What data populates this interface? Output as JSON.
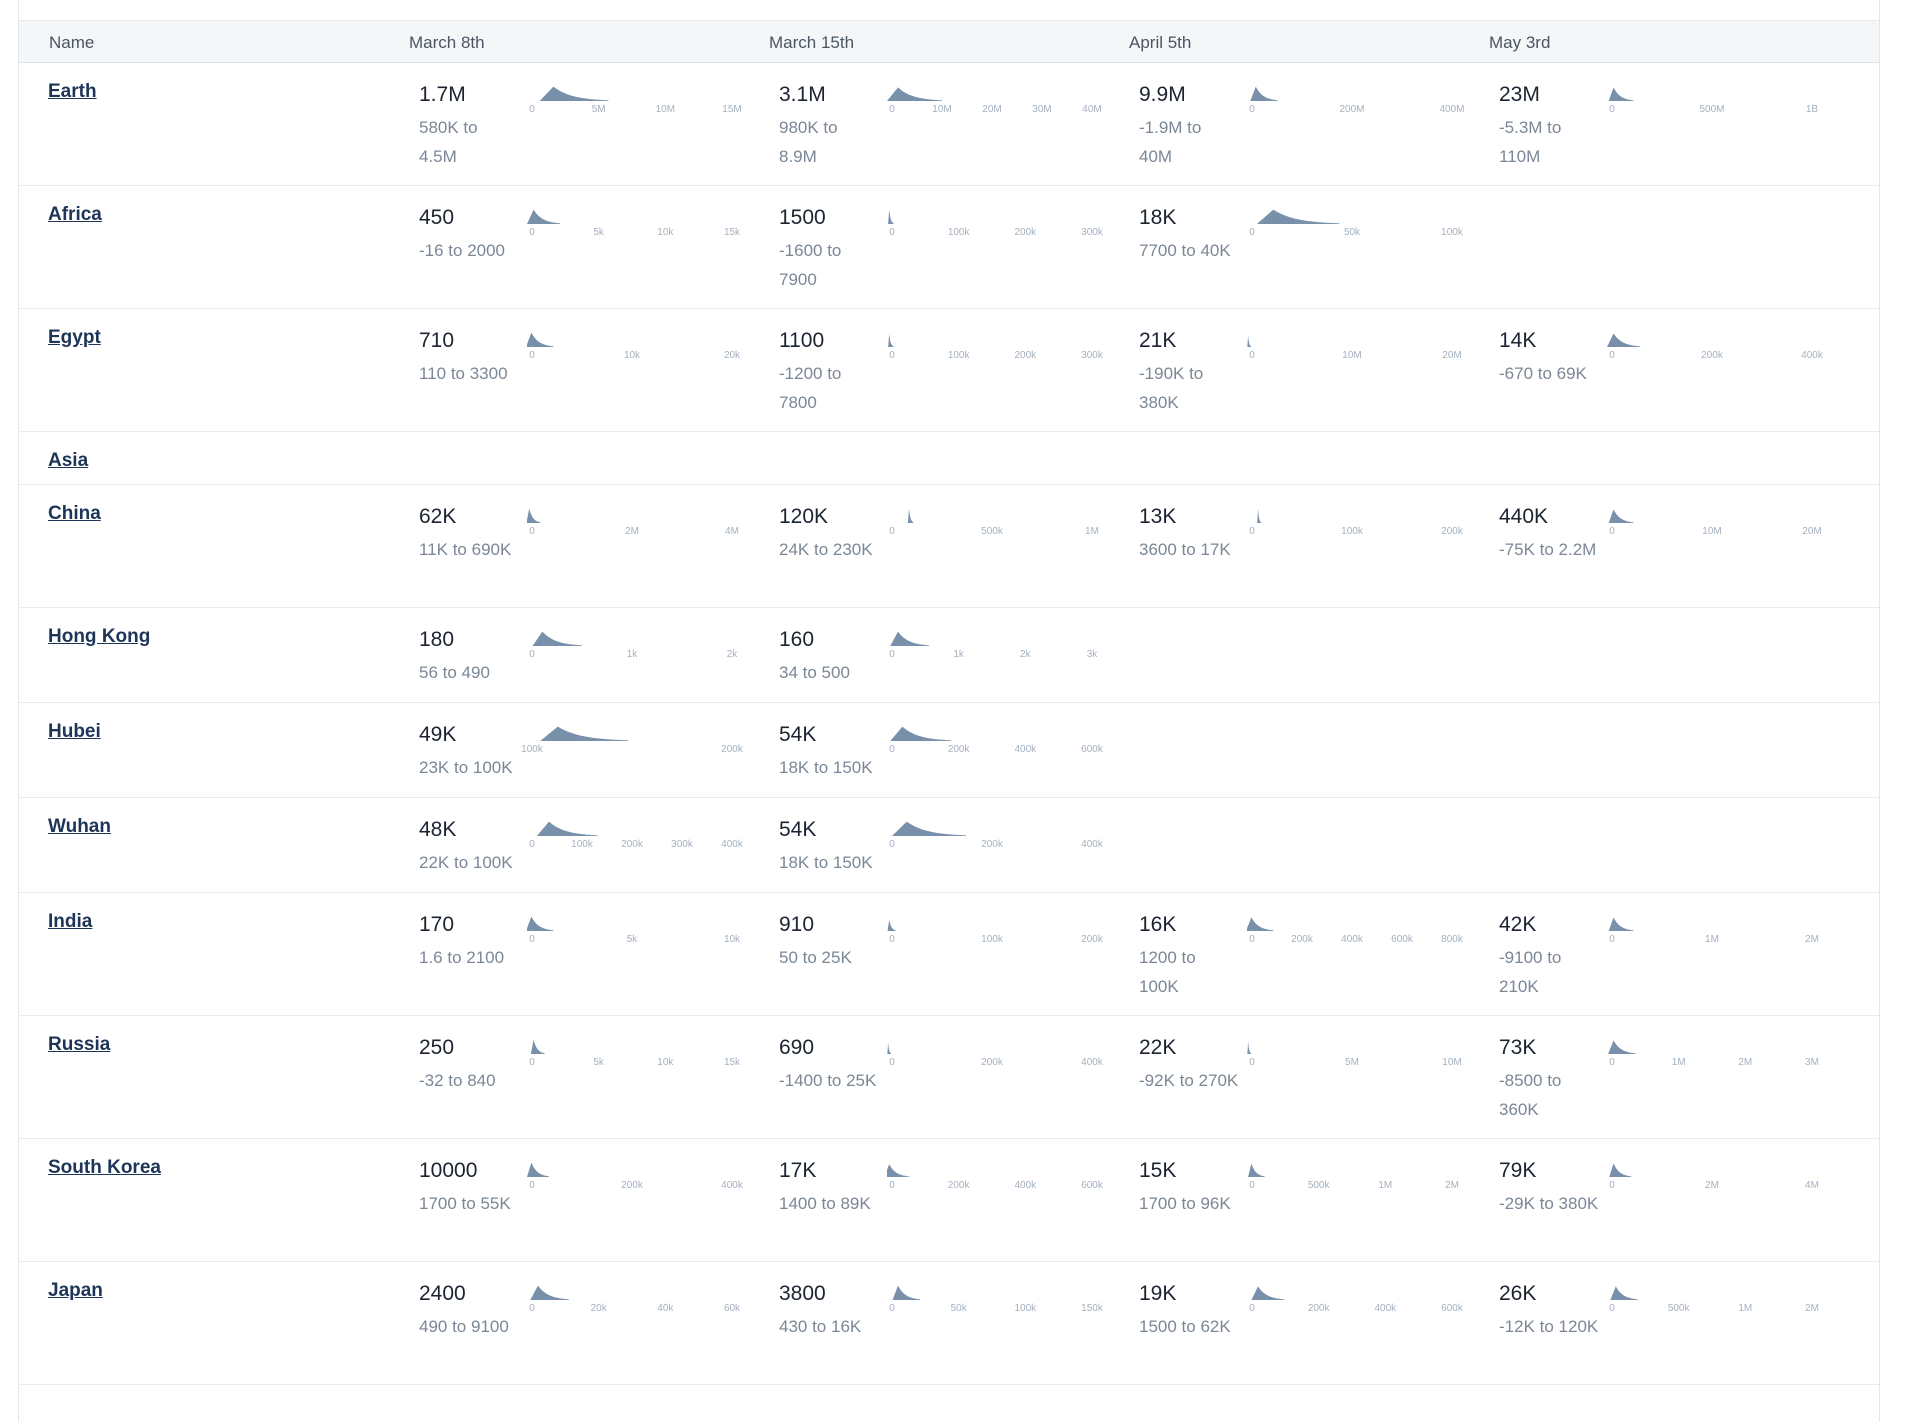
{
  "colors": {
    "spark_fill": "#7990aa",
    "link": "#1d3557",
    "header_bg": "#f5f6f8"
  },
  "columns": [
    "Name",
    "March 8th",
    "March 15th",
    "April 5th",
    "May 3rd"
  ],
  "rows": [
    {
      "name": "Earth",
      "cells": [
        {
          "value": "1.7M",
          "range": "580K to 4.5M",
          "ticks": [
            "0",
            "5M",
            "10M",
            "15M"
          ],
          "dist": {
            "peak": 0.12,
            "width": 0.25,
            "height": 0.9
          }
        },
        {
          "value": "3.1M",
          "range": "980K to 8.9M",
          "ticks": [
            "0",
            "10M",
            "20M",
            "30M",
            "40M"
          ],
          "dist": {
            "peak": 0.05,
            "width": 0.2,
            "height": 0.85
          }
        },
        {
          "value": "9.9M",
          "range": "-1.9M to 40M",
          "ticks": [
            "0",
            "200M",
            "400M"
          ],
          "dist": {
            "peak": 0.04,
            "width": 0.1,
            "height": 0.9
          }
        },
        {
          "value": "23M",
          "range": "-5.3M to 110M",
          "ticks": [
            "0",
            "500M",
            "1B"
          ],
          "dist": {
            "peak": 0.03,
            "width": 0.09,
            "height": 0.85
          }
        }
      ]
    },
    {
      "name": "Africa",
      "cells": [
        {
          "value": "450",
          "range": "-16 to 2000",
          "ticks": [
            "0",
            "5k",
            "10k",
            "15k"
          ],
          "dist": {
            "peak": 0.03,
            "width": 0.12,
            "height": 0.9
          }
        },
        {
          "value": "1500",
          "range": "-1600 to 7900",
          "ticks": [
            "0",
            "100k",
            "200k",
            "300k"
          ],
          "dist": {
            "peak": 0.01,
            "width": 0.02,
            "height": 0.9
          }
        },
        {
          "value": "18K",
          "range": "7700 to 40K",
          "ticks": [
            "0",
            "50k",
            "100k"
          ],
          "dist": {
            "peak": 0.12,
            "width": 0.3,
            "height": 0.9
          }
        },
        null
      ]
    },
    {
      "name": "Egypt",
      "cells": [
        {
          "value": "710",
          "range": "110 to 3300",
          "ticks": [
            "0",
            "10k",
            "20k"
          ],
          "dist": {
            "peak": 0.02,
            "width": 0.1,
            "height": 0.9
          }
        },
        {
          "value": "1100",
          "range": "-1200 to 7800",
          "ticks": [
            "0",
            "100k",
            "200k",
            "300k"
          ],
          "dist": {
            "peak": 0.01,
            "width": 0.02,
            "height": 0.8
          }
        },
        {
          "value": "21K",
          "range": "-190K to 380K",
          "ticks": [
            "0",
            "10M",
            "20M"
          ],
          "dist": {
            "peak": 0.005,
            "width": 0.01,
            "height": 0.7
          }
        },
        {
          "value": "14K",
          "range": "-670 to 69K",
          "ticks": [
            "0",
            "200k",
            "400k"
          ],
          "dist": {
            "peak": 0.03,
            "width": 0.12,
            "height": 0.85
          }
        }
      ]
    },
    {
      "name": "Asia",
      "cells": [
        null,
        null,
        null,
        null
      ]
    },
    {
      "name": "China",
      "cells": [
        {
          "value": "62K",
          "range": "11K to 690K",
          "ticks": [
            "0",
            "2M",
            "4M"
          ],
          "dist": {
            "peak": 0.01,
            "width": 0.05,
            "height": 0.9
          }
        },
        {
          "value": "120K",
          "range": "24K to 230K",
          "ticks": [
            "0",
            "500k",
            "1M"
          ],
          "dist": {
            "peak": 0.1,
            "width": 0.02,
            "height": 0.9
          }
        },
        {
          "value": "13K",
          "range": "3600 to 17K",
          "ticks": [
            "0",
            "100k",
            "200k"
          ],
          "dist": {
            "peak": 0.05,
            "width": 0.01,
            "height": 0.9
          }
        },
        {
          "value": "440K",
          "range": "-75K to 2.2M",
          "ticks": [
            "0",
            "10M",
            "20M"
          ],
          "dist": {
            "peak": 0.03,
            "width": 0.09,
            "height": 0.85
          }
        }
      ]
    },
    {
      "name": "Hong Kong",
      "cells": [
        {
          "value": "180",
          "range": "56 to 490",
          "ticks": [
            "0",
            "1k",
            "2k"
          ],
          "dist": {
            "peak": 0.07,
            "width": 0.18,
            "height": 0.9
          }
        },
        {
          "value": "160",
          "range": "34 to 500",
          "ticks": [
            "0",
            "1k",
            "2k",
            "3k"
          ],
          "dist": {
            "peak": 0.05,
            "width": 0.14,
            "height": 0.9
          }
        },
        null,
        null
      ]
    },
    {
      "name": "Hubei",
      "cells": [
        {
          "value": "49K",
          "range": "23K to 100K",
          "ticks": [
            "100k",
            "200k"
          ],
          "dist": {
            "peak": 0.14,
            "width": 0.32,
            "height": 0.9
          }
        },
        {
          "value": "54K",
          "range": "18K to 150K",
          "ticks": [
            "0",
            "200k",
            "400k",
            "600k"
          ],
          "dist": {
            "peak": 0.07,
            "width": 0.22,
            "height": 0.9
          }
        },
        null,
        null
      ]
    },
    {
      "name": "Wuhan",
      "cells": [
        {
          "value": "48K",
          "range": "22K to 100K",
          "ticks": [
            "0",
            "100k",
            "200k",
            "300k",
            "400k"
          ],
          "dist": {
            "peak": 0.1,
            "width": 0.22,
            "height": 0.9
          }
        },
        {
          "value": "54K",
          "range": "18K to 150K",
          "ticks": [
            "0",
            "200k",
            "400k"
          ],
          "dist": {
            "peak": 0.09,
            "width": 0.27,
            "height": 0.9
          }
        },
        null,
        null
      ]
    },
    {
      "name": "India",
      "cells": [
        {
          "value": "170",
          "range": "1.6 to 2100",
          "ticks": [
            "0",
            "5k",
            "10k"
          ],
          "dist": {
            "peak": 0.02,
            "width": 0.1,
            "height": 0.9
          }
        },
        {
          "value": "910",
          "range": "50 to 25K",
          "ticks": [
            "0",
            "100k",
            "200k"
          ],
          "dist": {
            "peak": 0.01,
            "width": 0.03,
            "height": 0.7
          }
        },
        {
          "value": "16K",
          "range": "1200 to 100K",
          "ticks": [
            "0",
            "200k",
            "400k",
            "600k",
            "800k"
          ],
          "dist": {
            "peak": 0.02,
            "width": 0.1,
            "height": 0.85
          }
        },
        {
          "value": "42K",
          "range": "-9100 to 210K",
          "ticks": [
            "0",
            "1M",
            "2M"
          ],
          "dist": {
            "peak": 0.03,
            "width": 0.09,
            "height": 0.85
          }
        }
      ]
    },
    {
      "name": "Russia",
      "cells": [
        {
          "value": "250",
          "range": "-32 to 840",
          "ticks": [
            "0",
            "5k",
            "10k",
            "15k"
          ],
          "dist": {
            "peak": 0.03,
            "width": 0.05,
            "height": 0.9
          }
        },
        {
          "value": "690",
          "range": "-1400 to 25K",
          "ticks": [
            "0",
            "200k",
            "400k"
          ],
          "dist": {
            "peak": 0.005,
            "width": 0.01,
            "height": 0.7
          }
        },
        {
          "value": "22K",
          "range": "-92K to 270K",
          "ticks": [
            "0",
            "5M",
            "10M"
          ],
          "dist": {
            "peak": 0.005,
            "width": 0.01,
            "height": 0.8
          }
        },
        {
          "value": "73K",
          "range": "-8500 to 360K",
          "ticks": [
            "0",
            "1M",
            "2M",
            "3M"
          ],
          "dist": {
            "peak": 0.03,
            "width": 0.1,
            "height": 0.85
          }
        }
      ]
    },
    {
      "name": "South Korea",
      "cells": [
        {
          "value": "10000",
          "range": "1700 to 55K",
          "ticks": [
            "0",
            "200k",
            "400k"
          ],
          "dist": {
            "peak": 0.02,
            "width": 0.08,
            "height": 0.9
          }
        },
        {
          "value": "17K",
          "range": "1400 to 89K",
          "ticks": [
            "0",
            "200k",
            "400k",
            "600k"
          ],
          "dist": {
            "peak": 0.01,
            "width": 0.09,
            "height": 0.8
          }
        },
        {
          "value": "15K",
          "range": "1700 to 96K",
          "ticks": [
            "0",
            "500k",
            "1M",
            "2M"
          ],
          "dist": {
            "peak": 0.02,
            "width": 0.06,
            "height": 0.85
          }
        },
        {
          "value": "79K",
          "range": "-29K to 380K",
          "ticks": [
            "0",
            "2M",
            "4M"
          ],
          "dist": {
            "peak": 0.03,
            "width": 0.08,
            "height": 0.85
          }
        }
      ]
    },
    {
      "name": "Japan",
      "cells": [
        {
          "value": "2400",
          "range": "490 to 9100",
          "ticks": [
            "0",
            "20k",
            "40k",
            "60k"
          ],
          "dist": {
            "peak": 0.05,
            "width": 0.14,
            "height": 0.9
          }
        },
        {
          "value": "3800",
          "range": "430 to 16K",
          "ticks": [
            "0",
            "50k",
            "100k",
            "150k"
          ],
          "dist": {
            "peak": 0.05,
            "width": 0.1,
            "height": 0.9
          }
        },
        {
          "value": "19K",
          "range": "1500 to 62K",
          "ticks": [
            "0",
            "200k",
            "400k",
            "600k"
          ],
          "dist": {
            "peak": 0.05,
            "width": 0.12,
            "height": 0.85
          }
        },
        {
          "value": "26K",
          "range": "-12K to 120K",
          "ticks": [
            "0",
            "500k",
            "1M",
            "2M"
          ],
          "dist": {
            "peak": 0.04,
            "width": 0.1,
            "height": 0.85
          }
        }
      ]
    }
  ]
}
